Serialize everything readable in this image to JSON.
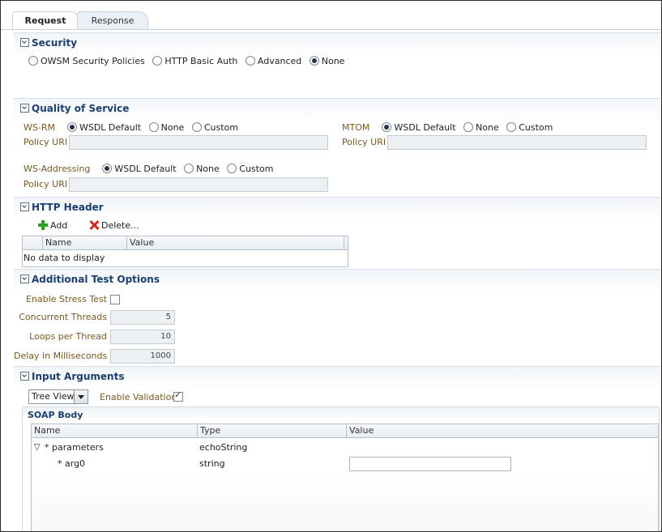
{
  "tabs": {
    "request": "Request",
    "response": "Response"
  },
  "security": {
    "title": "Security",
    "options": [
      "OWSM Security Policies",
      "HTTP Basic Auth",
      "Advanced",
      "None"
    ],
    "selected": "None"
  },
  "qos": {
    "title": "Quality of Service",
    "ws_rm": {
      "label": "WS-RM",
      "options": [
        "WSDL Default",
        "None",
        "Custom"
      ],
      "selected": "WSDL Default",
      "policy_label": "Policy URI"
    },
    "mtom": {
      "label": "MTOM",
      "options": [
        "WSDL Default",
        "None",
        "Custom"
      ],
      "selected": "WSDL Default",
      "policy_label": "Policy URI"
    },
    "ws_addressing": {
      "label": "WS-Addressing",
      "options": [
        "WSDL Default",
        "None",
        "Custom"
      ],
      "selected": "WSDL Default",
      "policy_label": "Policy URI"
    }
  },
  "http_header": {
    "title": "HTTP Header",
    "add_label": "Add",
    "delete_label": "Delete...",
    "columns": [
      "Name",
      "Value"
    ],
    "empty_text": "No data to display"
  },
  "test_options": {
    "title": "Additional Test Options",
    "stress_label": "Enable Stress Test",
    "stress_checked": false,
    "threads_label": "Concurrent Threads",
    "threads_value": "5",
    "loops_label": "Loops per Thread",
    "loops_value": "10",
    "delay_label": "Delay in Milliseconds",
    "delay_value": "1000"
  },
  "input_args": {
    "title": "Input Arguments",
    "view_selected": "Tree View",
    "validation_label": "Enable Validation",
    "validation_checked": true,
    "soap_body_title": "SOAP Body",
    "columns": [
      "Name",
      "Type",
      "Value"
    ],
    "rows": [
      {
        "name": "* parameters",
        "type": "echoString",
        "expandable": true
      },
      {
        "name": "* arg0",
        "type": "string",
        "has_input": true
      }
    ]
  },
  "icons": {
    "expand": "triangle-down-icon",
    "add": "plus-icon",
    "delete": "red-x-icon",
    "collapse": "chevron-down-icon"
  }
}
